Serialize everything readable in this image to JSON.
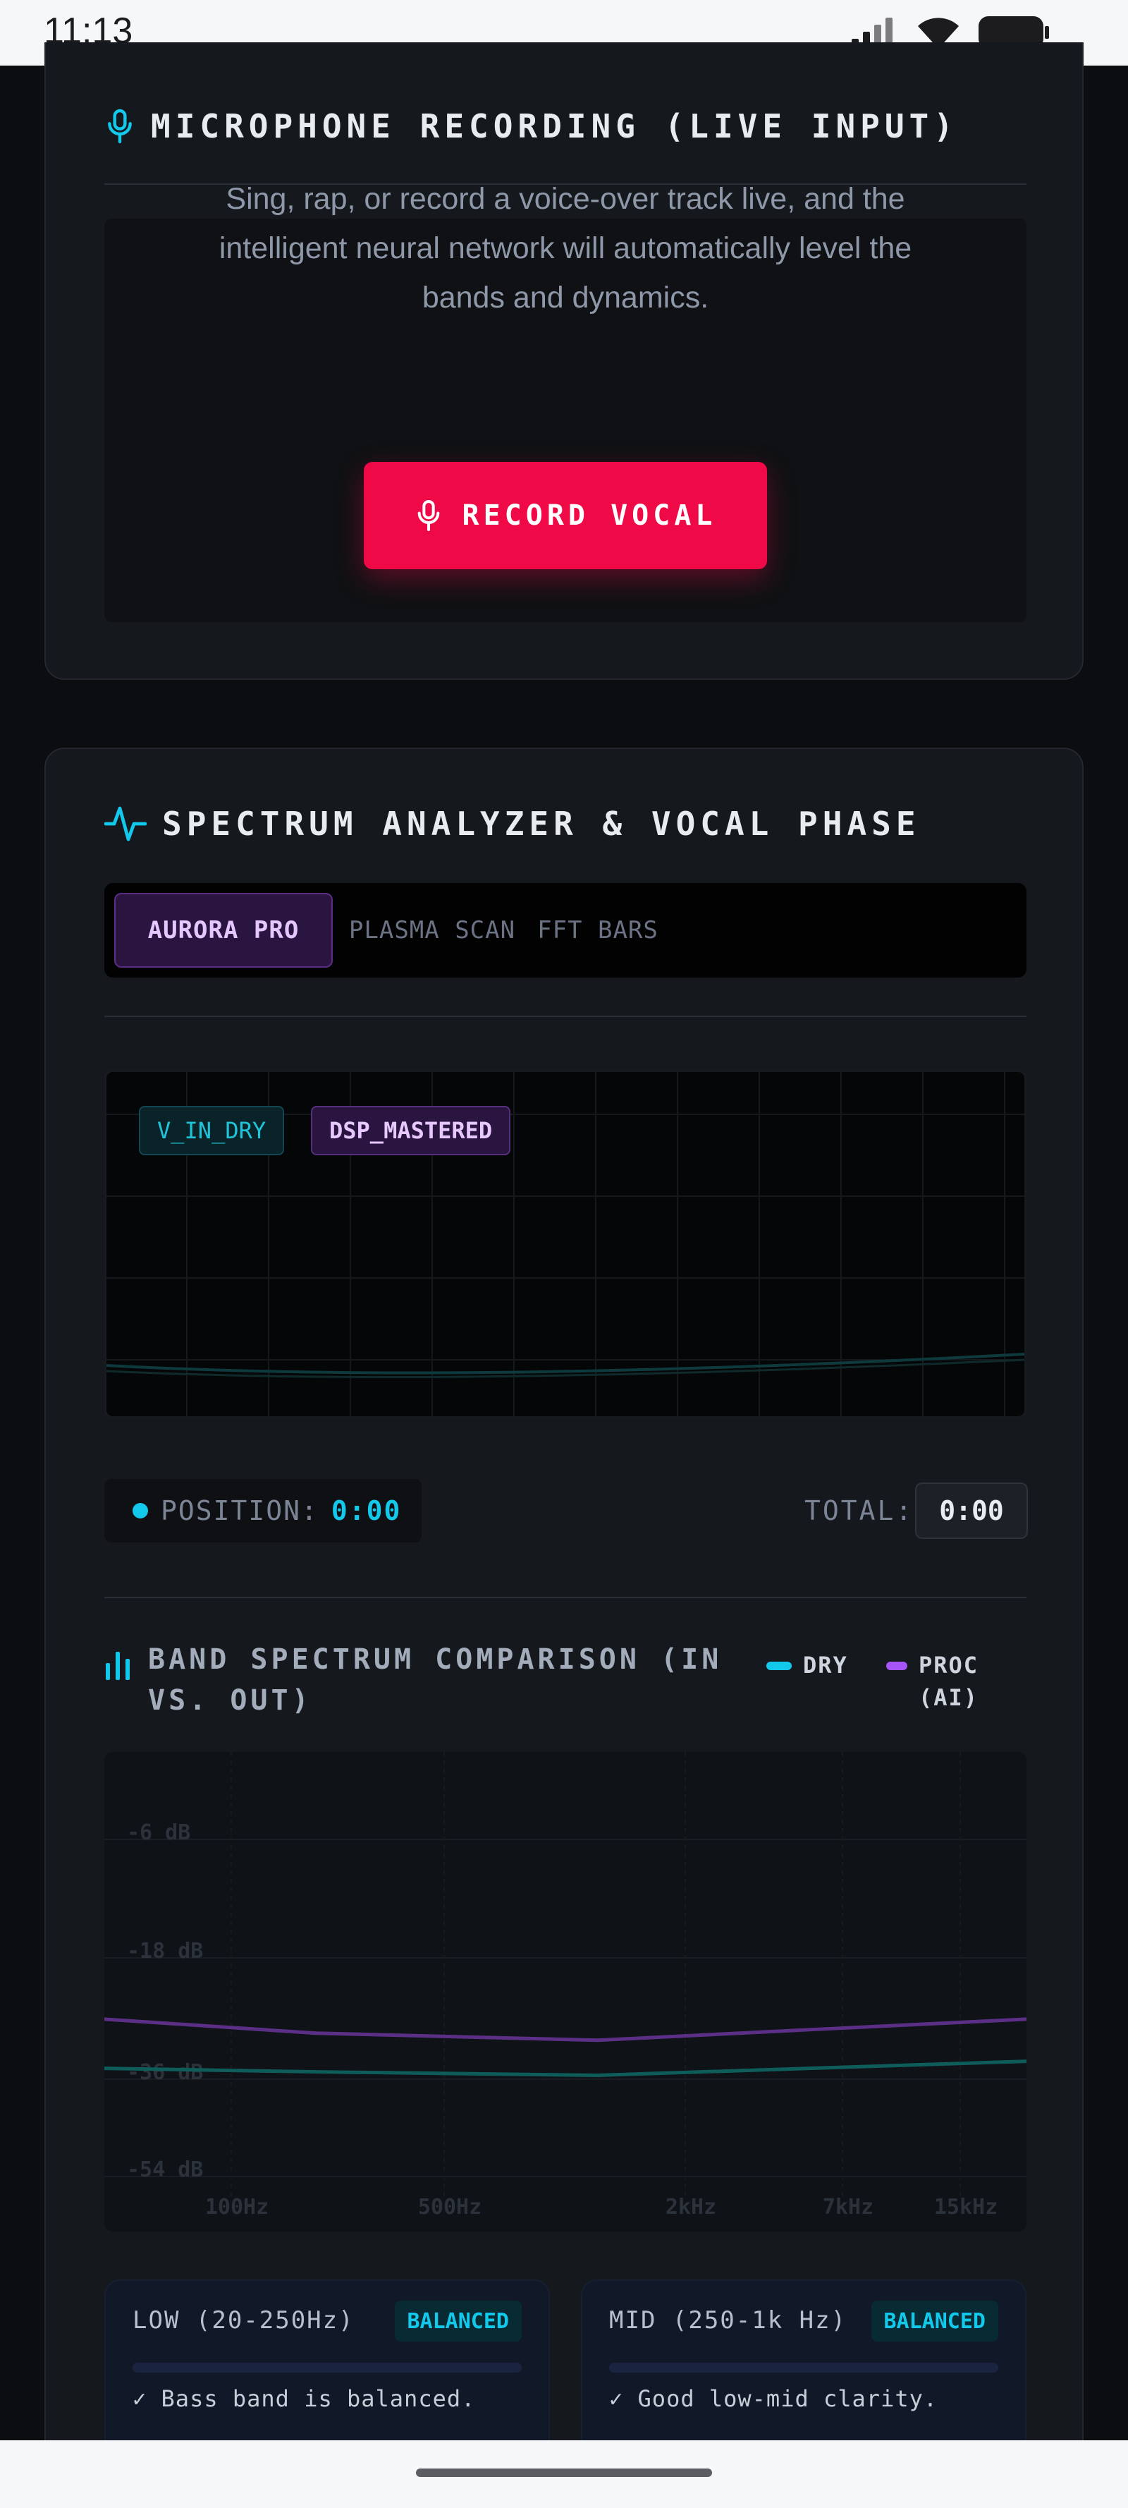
{
  "status_bar": {
    "time": "11:13"
  },
  "mic_section": {
    "title": "MICROPHONE RECORDING (LIVE INPUT)",
    "description": "Sing, rap, or record a voice-over track live, and the intelligent neural network will automatically level the bands and dynamics.",
    "record_button": "RECORD VOCAL"
  },
  "spectrum_section": {
    "title": "SPECTRUM ANALYZER & VOCAL PHASE",
    "tabs": [
      {
        "label": "AURORA PRO",
        "active": true
      },
      {
        "label": "PLASMA SCAN",
        "active": false
      },
      {
        "label": "FFT BARS",
        "active": false
      }
    ],
    "scope_chips": {
      "dry": "V_IN_DRY",
      "mastered": "DSP_MASTERED"
    },
    "position_label": "POSITION:",
    "position_value": "0:00",
    "total_label": "TOTAL:",
    "total_value": "0:00"
  },
  "band_comparison": {
    "title": "BAND SPECTRUM COMPARISON (IN VS. OUT)",
    "legend": [
      {
        "label": "DRY",
        "color": "#12c9ec"
      },
      {
        "label": "PROC (AI)",
        "color": "#a855f7"
      }
    ],
    "cards": [
      {
        "label": "LOW (20-250Hz)",
        "badge": "BALANCED",
        "note": "✓ Bass band is balanced."
      },
      {
        "label": "MID (250-1k Hz)",
        "badge": "BALANCED",
        "note": "✓ Good low-mid clarity."
      }
    ]
  },
  "chart_data": {
    "type": "line",
    "x": [
      "100Hz",
      "500Hz",
      "2kHz",
      "7kHz",
      "15kHz"
    ],
    "y_ticks": [
      "-6 dB",
      "-18 dB",
      "-36 dB",
      "-54 dB"
    ],
    "series": [
      {
        "name": "DRY",
        "values": [
          -40,
          -40.5,
          -41,
          -40,
          -39
        ]
      },
      {
        "name": "PROC (AI)",
        "values": [
          -33,
          -35,
          -36,
          -34.5,
          -33
        ]
      }
    ],
    "ylim": [
      -58,
      0
    ]
  },
  "colors": {
    "accent_cyan": "#12c9ec",
    "accent_purple": "#a855f7",
    "record_red": "#ef0a47"
  }
}
